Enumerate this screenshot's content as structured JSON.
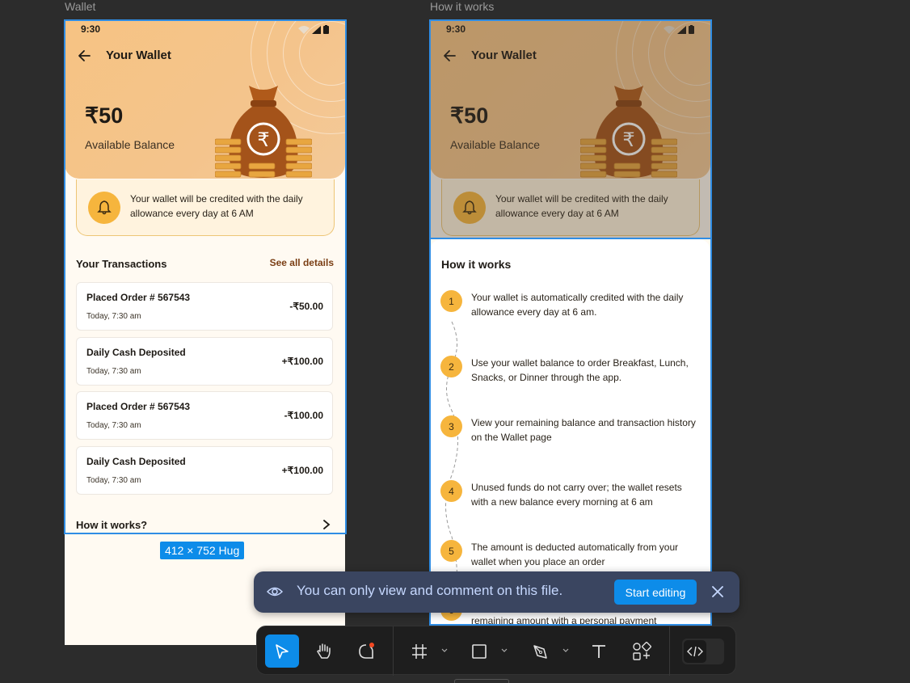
{
  "canvas": {
    "frames": [
      {
        "label": "Wallet"
      },
      {
        "label": "How it works"
      }
    ],
    "selection_size": "412 × 752 Hug"
  },
  "wallet": {
    "time": "9:30",
    "title": "Your Wallet",
    "balance": "₹50",
    "balance_label": "Available Balance",
    "notice": "Your wallet will be credited with the daily allowance every day at 6 AM",
    "transactions_title": "Your Transactions",
    "see_all": "See all details",
    "transactions": [
      {
        "name": "Placed Order # 567543",
        "time": "Today, 7:30 am",
        "amount": "-₹50.00"
      },
      {
        "name": "Daily Cash Deposited",
        "time": "Today, 7:30 am",
        "amount": "+₹100.00"
      },
      {
        "name": "Placed Order # 567543",
        "time": "Today, 7:30 am",
        "amount": "-₹100.00"
      },
      {
        "name": "Daily Cash Deposited",
        "time": "Today, 7:30 am",
        "amount": "+₹100.00"
      }
    ],
    "how_it_works": "How it works?"
  },
  "how_sheet": {
    "title": "How it works",
    "steps": [
      {
        "num": "1",
        "text": "Your wallet is automatically credited with the daily allowance every day at 6 am."
      },
      {
        "num": "2",
        "text": "Use your wallet balance to order Breakfast, Lunch, Snacks, or Dinner through the app."
      },
      {
        "num": "3",
        "text": "View your remaining balance and transaction history on the Wallet page"
      },
      {
        "num": "4",
        "text": "Unused funds do not carry over; the wallet resets with a new balance every morning at 6 am"
      },
      {
        "num": "5",
        "text": "The amount is deducted automatically from your wallet when you place an order"
      },
      {
        "num": "6",
        "text": "remaining amount with a personal payment"
      }
    ]
  },
  "toast": {
    "message": "You can only view and comment on this file.",
    "button": "Start editing"
  },
  "toolbar": {
    "tools": [
      "move-tool",
      "hand-tool",
      "comment-tool",
      "frame-tool",
      "shape-tool",
      "pen-tool",
      "text-tool",
      "resources-tool",
      "dev-mode-toggle"
    ],
    "active": "move-tool"
  },
  "colors": {
    "accent": "#0d8ce9",
    "wallet_gradient": "#f6c383",
    "step_badge": "#f6b53d",
    "brand_brown": "#7a3e14"
  }
}
